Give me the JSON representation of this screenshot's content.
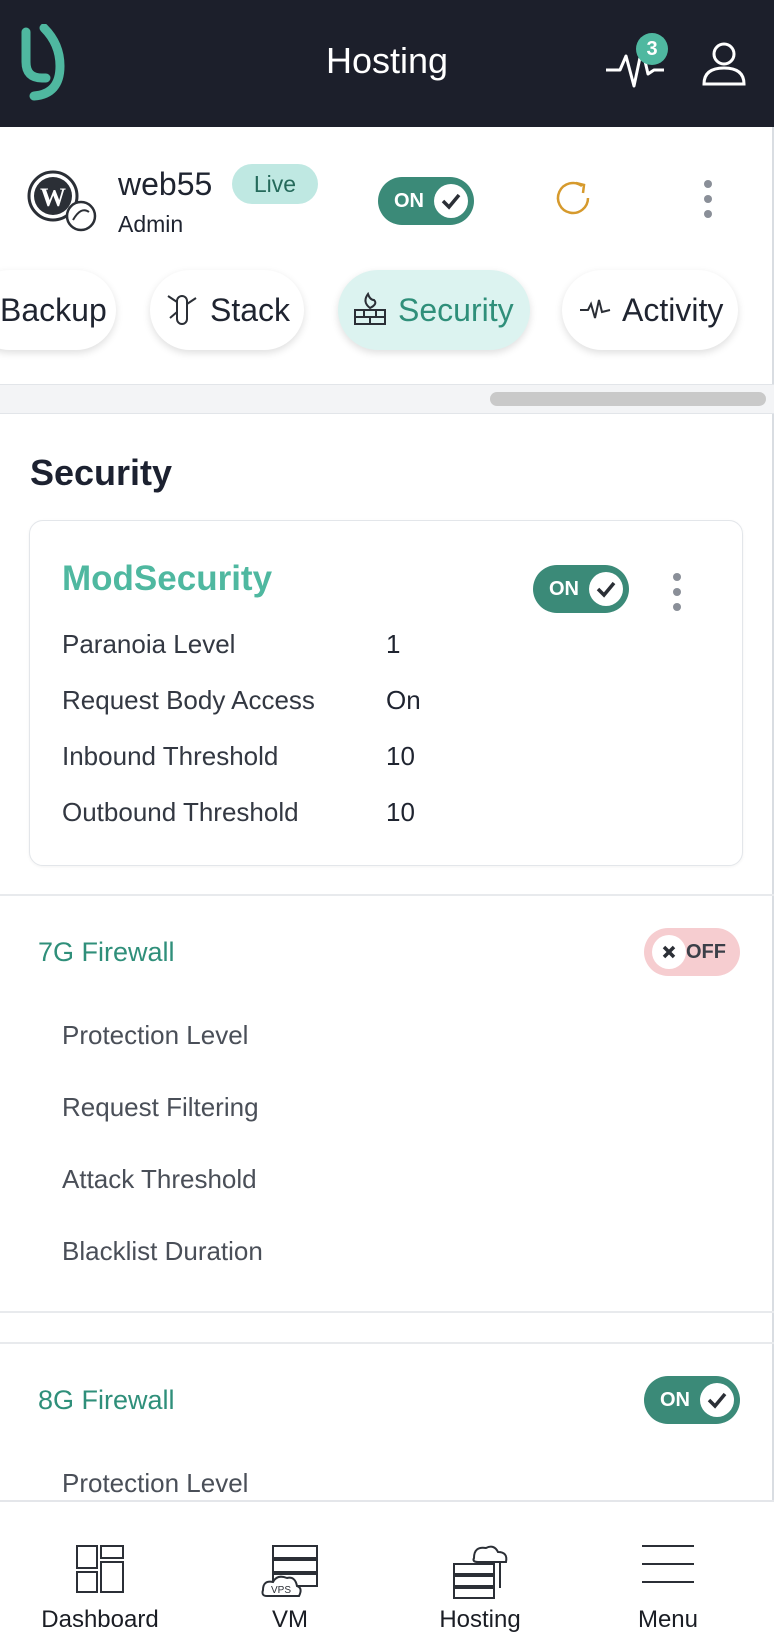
{
  "header": {
    "title": "Hosting",
    "notification_count": "3"
  },
  "site": {
    "name": "web55",
    "status_badge": "Live",
    "role": "Admin",
    "toggle_label": "ON"
  },
  "tabs": [
    {
      "label": "Backup",
      "active": false
    },
    {
      "label": "Stack",
      "active": false
    },
    {
      "label": "Security",
      "active": true
    },
    {
      "label": "Activity",
      "active": false
    }
  ],
  "section": {
    "title": "Security"
  },
  "modsecurity": {
    "title": "ModSecurity",
    "toggle_label": "ON",
    "rows": [
      {
        "label": "Paranoia Level",
        "value": "1"
      },
      {
        "label": "Request Body Access",
        "value": "On"
      },
      {
        "label": "Inbound Threshold",
        "value": "10"
      },
      {
        "label": "Outbound Threshold",
        "value": "10"
      }
    ]
  },
  "firewall_7g": {
    "title": "7G Firewall",
    "toggle_label": "OFF",
    "items": [
      "Protection Level",
      "Request Filtering",
      "Attack Threshold",
      "Blacklist Duration"
    ]
  },
  "firewall_8g": {
    "title": "8G Firewall",
    "toggle_label": "ON",
    "items": [
      "Protection Level"
    ]
  },
  "bottom_nav": [
    {
      "label": "Dashboard",
      "icon": "dashboard-icon"
    },
    {
      "label": "VM",
      "icon": "vps-server-icon",
      "icon_text": "VPS"
    },
    {
      "label": "Hosting",
      "icon": "cloud-server-icon"
    },
    {
      "label": "Menu",
      "icon": "hamburger-menu-icon"
    }
  ],
  "colors": {
    "header_bg": "#1c1f2b",
    "accent": "#4fb8a0",
    "toggle_on": "#3b8a78",
    "toggle_off": "#f6cdd0",
    "tab_active_bg": "#dcf3f0"
  }
}
